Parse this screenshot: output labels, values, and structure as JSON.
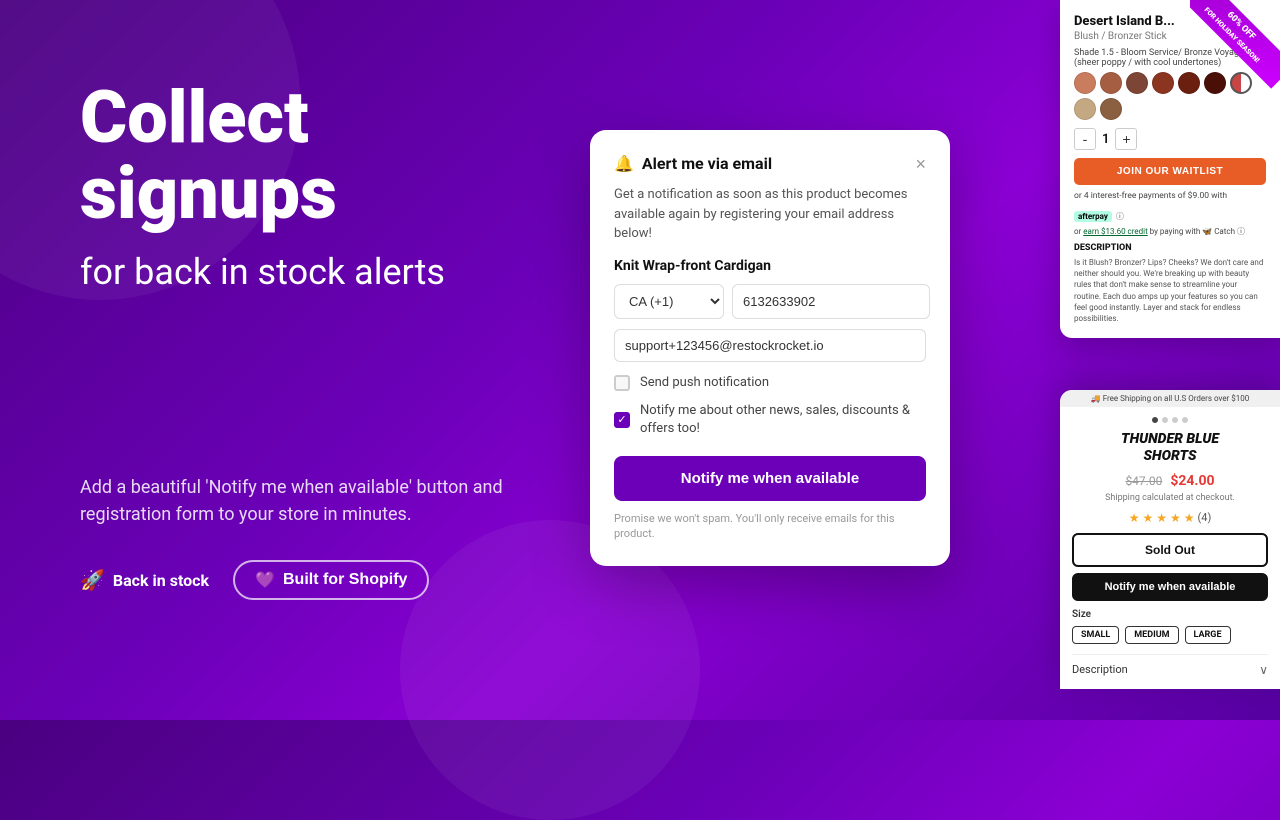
{
  "left": {
    "headline": "Collect signups",
    "subheadline": "for back in stock alerts",
    "description": "Add a beautiful 'Notify me when available' button and registration form to your store in minutes.",
    "badge_back_label": "Back in stock",
    "badge_shopify_label": "Built for Shopify"
  },
  "modal": {
    "title": "Alert me via email",
    "close_label": "×",
    "description": "Get a notification as soon as this product becomes available again by registering your email address below!",
    "product_name": "Knit Wrap-front Cardigan",
    "phone_country": "CA (+1)",
    "phone_number": "6132633902",
    "email_value": "support+123456@restockrocket.io",
    "push_label": "Send push notification",
    "news_label": "Notify me about other news, sales, discounts & offers too!",
    "notify_btn": "Notify me when available",
    "spam_note": "Promise we won't spam. You'll only receive emails for this product."
  },
  "right_top": {
    "product_title": "Desert Island B...",
    "product_subtitle": "Blush / Bronzer Stick",
    "shade_label": "Shade 1.5 - Bloom Service/ Bronze Voyage (sheer poppy / with cool undertones)",
    "swatches": [
      {
        "color": "#c97c5e"
      },
      {
        "color": "#a55e42"
      },
      {
        "color": "#7d4535"
      },
      {
        "color": "#8b3520"
      },
      {
        "color": "#6b1f0f"
      },
      {
        "color": "#4a1008"
      },
      {
        "color": "#c94444",
        "half": true
      },
      {
        "color": "#c4a882"
      },
      {
        "color": "#8a6040"
      }
    ],
    "qty_minus": "-",
    "qty_value": "1",
    "qty_plus": "+",
    "waitlist_btn": "JOIN OUR WAITLIST",
    "afterpay_text": "or 4 interest-free payments of $9.00 with",
    "afterpay_badge": "afterpay",
    "afterpay_info": "ⓘ",
    "catch_text": "or earn $13.60 credit by paying with 🦋 Catch",
    "catch_link": "earn $13.60 credit",
    "desc_heading": "DESCRIPTION",
    "desc_text": "Is it Blush? Bronzer? Lips? Cheeks? We don't care and neither should you. We're breaking up with beauty rules that don't make sense to streamline your routine. Each duo amps up your features so you can feel good instantly. Layer and stack for endless possibilities.",
    "ribbon_line1": "60%",
    "ribbon_line2": "OFF",
    "ribbon_sub": "FOR HOLIDAY SEASON!"
  },
  "right_bottom": {
    "free_shipping": "🚚 Free Shipping on all U.S Orders over $100",
    "product_name_line1": "THUNDER BLUE",
    "product_name_line2": "SHORTS",
    "old_price": "$47.00",
    "new_price": "$24.00",
    "shipping_label": "Shipping calculated at checkout.",
    "stars_count": 5,
    "review_count": "(4)",
    "sold_out_btn": "Sold Out",
    "notify_btn": "Notify me when available",
    "size_label": "Size",
    "sizes": [
      "SMALL",
      "MEDIUM",
      "LARGE"
    ],
    "description_label": "Description"
  },
  "colors": {
    "purple_accent": "#6b00b8",
    "orange_btn": "#e85d26",
    "dark_btn": "#111111"
  }
}
